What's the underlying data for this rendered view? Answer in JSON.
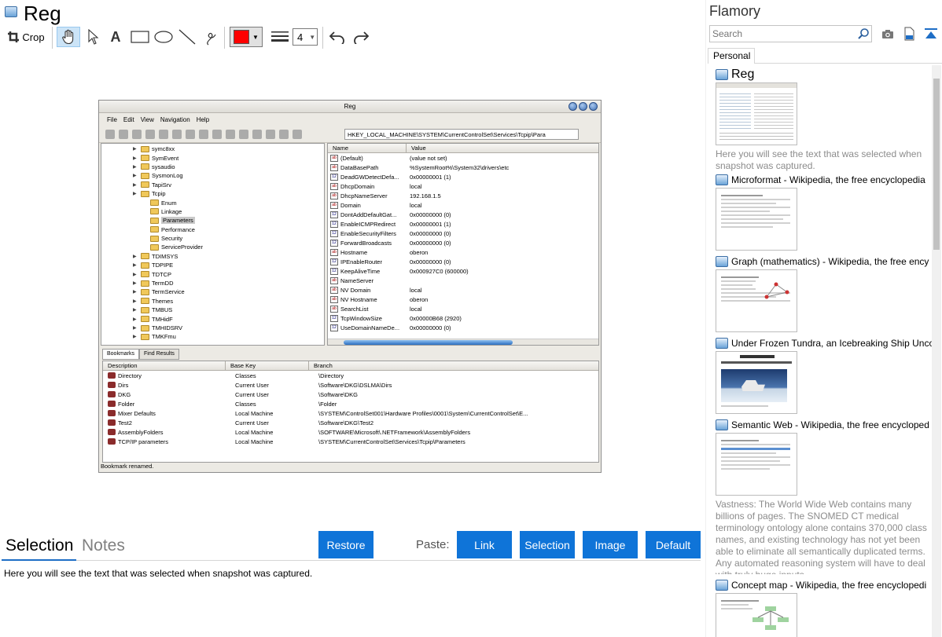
{
  "app": {
    "title": "Reg",
    "crop_label": "Crop",
    "line_width": "4"
  },
  "snapshot": {
    "window_title": "Reg",
    "menu": [
      "File",
      "Edit",
      "View",
      "Navigation",
      "Help"
    ],
    "path": "HKEY_LOCAL_MACHINE\\SYSTEM\\CurrentControlSet\\Services\\Tcpip\\Para",
    "tree": [
      {
        "label": "symc8xx",
        "indent": 0
      },
      {
        "label": "SymEvent",
        "indent": 0
      },
      {
        "label": "sysaudio",
        "indent": 0
      },
      {
        "label": "SysmonLog",
        "indent": 0
      },
      {
        "label": "TapiSrv",
        "indent": 0
      },
      {
        "label": "Tcpip",
        "indent": 0
      },
      {
        "label": "Enum",
        "indent": 1
      },
      {
        "label": "Linkage",
        "indent": 1
      },
      {
        "label": "Parameters",
        "indent": 1
      },
      {
        "label": "Performance",
        "indent": 1
      },
      {
        "label": "Security",
        "indent": 1
      },
      {
        "label": "ServiceProvider",
        "indent": 1
      },
      {
        "label": "TDIMSYS",
        "indent": 0
      },
      {
        "label": "TDPIPE",
        "indent": 0
      },
      {
        "label": "TDTCP",
        "indent": 0
      },
      {
        "label": "TermDD",
        "indent": 0
      },
      {
        "label": "TermService",
        "indent": 0
      },
      {
        "label": "Themes",
        "indent": 0
      },
      {
        "label": "TMBUS",
        "indent": 0
      },
      {
        "label": "TMHidF",
        "indent": 0
      },
      {
        "label": "TMHIDSRV",
        "indent": 0
      },
      {
        "label": "TMKFmu",
        "indent": 0
      }
    ],
    "values_header": [
      "Name",
      "Value"
    ],
    "values": [
      {
        "icon": "ab",
        "name": "(Default)",
        "value": "(value not set)"
      },
      {
        "icon": "ab",
        "name": "DataBasePath",
        "value": "%SystemRoot%\\System32\\drivers\\etc"
      },
      {
        "icon": "12",
        "name": "DeadGWDetectDefa...",
        "value": "0x00000001 (1)"
      },
      {
        "icon": "ab",
        "name": "DhcpDomain",
        "value": "local"
      },
      {
        "icon": "ab",
        "name": "DhcpNameServer",
        "value": "192.168.1.5"
      },
      {
        "icon": "ab",
        "name": "Domain",
        "value": "local"
      },
      {
        "icon": "12",
        "name": "DontAddDefaultGat...",
        "value": "0x00000000 (0)"
      },
      {
        "icon": "12",
        "name": "EnableICMPRedirect",
        "value": "0x00000001 (1)"
      },
      {
        "icon": "12",
        "name": "EnableSecurityFilters",
        "value": "0x00000000 (0)"
      },
      {
        "icon": "12",
        "name": "ForwardBroadcasts",
        "value": "0x00000000 (0)"
      },
      {
        "icon": "ab",
        "name": "Hostname",
        "value": "oberon"
      },
      {
        "icon": "12",
        "name": "IPEnableRouter",
        "value": "0x00000000 (0)"
      },
      {
        "icon": "12",
        "name": "KeepAliveTime",
        "value": "0x000927C0 (600000)"
      },
      {
        "icon": "ab",
        "name": "NameServer",
        "value": ""
      },
      {
        "icon": "ab",
        "name": "NV Domain",
        "value": "local"
      },
      {
        "icon": "ab",
        "name": "NV Hostname",
        "value": "oberon"
      },
      {
        "icon": "ab",
        "name": "SearchList",
        "value": "local"
      },
      {
        "icon": "12",
        "name": "TcpWindowSize",
        "value": "0x00000B68 (2920)"
      },
      {
        "icon": "12",
        "name": "UseDomainNameDe...",
        "value": "0x00000000 (0)"
      }
    ],
    "tabs": [
      "Bookmarks",
      "Find Results"
    ],
    "bookmarks_header": [
      "Description",
      "Base Key",
      "Branch"
    ],
    "bookmarks": [
      {
        "desc": "Directory",
        "base": "Classes",
        "branch": "\\Directory"
      },
      {
        "desc": "Dirs",
        "base": "Current User",
        "branch": "\\Software\\DKG\\DSLMA\\Dirs"
      },
      {
        "desc": "DKG",
        "base": "Current User",
        "branch": "\\Software\\DKG"
      },
      {
        "desc": "Folder",
        "base": "Classes",
        "branch": "\\Folder"
      },
      {
        "desc": "Mixer Defaults",
        "base": "Local Machine",
        "branch": "\\SYSTEM\\ControlSet001\\Hardware Profiles\\0001\\System\\CurrentControlSet\\E..."
      },
      {
        "desc": "Test2",
        "base": "Current User",
        "branch": "\\Software\\DKG\\Test2"
      },
      {
        "desc": "AssemblyFolders",
        "base": "Local Machine",
        "branch": "\\SOFTWARE\\Microsoft\\.NETFramework\\AssemblyFolders"
      },
      {
        "desc": "TCP/IP parameters",
        "base": "Local Machine",
        "branch": "\\SYSTEM\\CurrentControlSet\\Services\\Tcpip\\Parameters"
      }
    ],
    "status": "Bookmark renamed."
  },
  "lower": {
    "tab_selection": "Selection",
    "tab_notes": "Notes",
    "restore": "Restore",
    "paste_label": "Paste:",
    "paste_link": "Link",
    "paste_selection": "Selection",
    "paste_image": "Image",
    "paste_default": "Default",
    "selection_text": "Here you will see the text that was selected when snapshot was captured."
  },
  "panel": {
    "title": "Flamory",
    "search_placeholder": "Search",
    "tab_personal": "Personal",
    "items": [
      {
        "title": "Reg",
        "desc": "Here you will see the text that was selected when snapshot was captured."
      },
      {
        "title": "Microformat - Wikipedia, the free encyclopedia",
        "desc": ""
      },
      {
        "title": "Graph (mathematics) - Wikipedia, the free ency",
        "desc": ""
      },
      {
        "title": "Under Frozen Tundra, an Icebreaking Ship Unco",
        "desc": ""
      },
      {
        "title": "Semantic Web - Wikipedia, the free encycloped",
        "desc": "Vastness: The World Wide Web contains many billions of pages. The SNOMED CT medical terminology ontology alone contains 370,000 class names, and existing technology has not yet been able to eliminate all semantically duplicated terms. Any automated reasoning system will have to deal with truly huge inputs."
      },
      {
        "title": "Concept map - Wikipedia, the free encyclopedi",
        "desc": ""
      }
    ]
  },
  "colors": {
    "accent": "#0f74d8",
    "pen_color": "#ff0000",
    "tab_underline": "#1e6ec6"
  }
}
